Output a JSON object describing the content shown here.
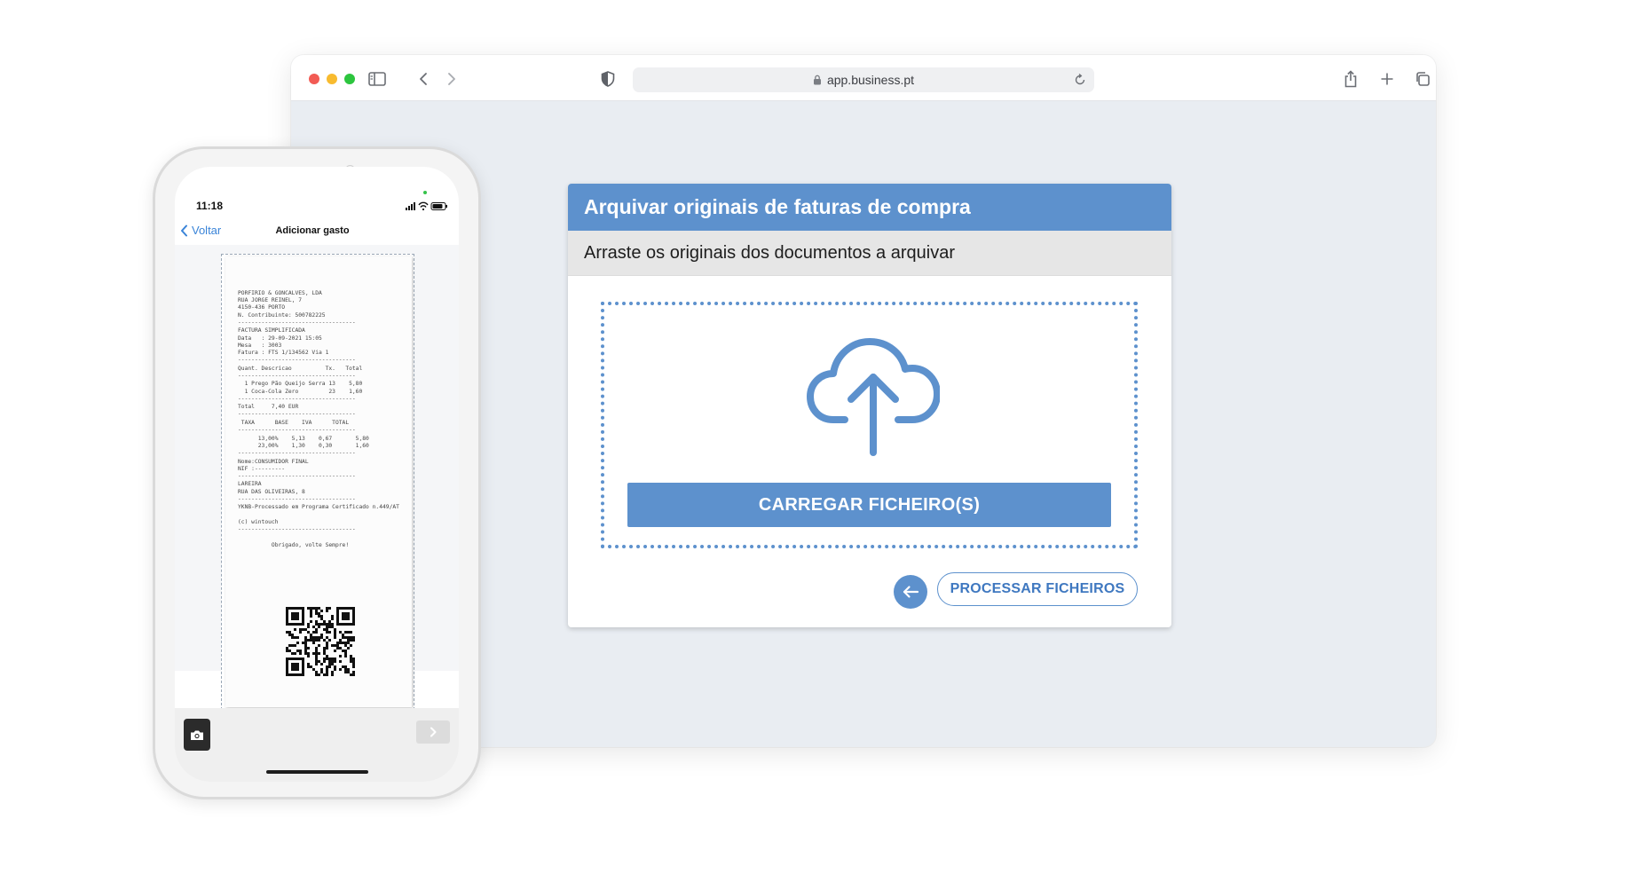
{
  "browser": {
    "url": "app.business.pt"
  },
  "card": {
    "title": "Arquivar originais de faturas de compra",
    "subtitle": "Arraste os originais dos documentos a arquivar",
    "upload_label": "CARREGAR FICHEIRO(S)",
    "process_label": "PROCESSAR FICHEIROS"
  },
  "phone": {
    "time": "11:18",
    "back_label": "Voltar",
    "title": "Adicionar gasto",
    "receipt_lines": [
      "PORFIRIO & GONCALVES, LDA",
      "RUA JORGE REINEL, 7",
      "4150-436 PORTO",
      "N. Contribuinte: 500782225",
      "-----------------------------------",
      "FACTURA SIMPLIFICADA",
      "Data   : 29-09-2021 15:05",
      "Mesa   : 3003",
      "Fatura : FTS 1/134562 Via 1",
      "-----------------------------------",
      "Quant. Descricao          Tx.   Total",
      "-----------------------------------",
      "  1 Prego Pão Queijo Serra 13    5,80",
      "  1 Coca-Cola Zero         23    1,60",
      "-----------------------------------",
      "Total     7,40 EUR",
      "-----------------------------------",
      " TAXA      BASE    IVA      TOTAL",
      "-----------------------------------",
      "      13,00%    5,13    0,67       5,80",
      "      23,00%    1,30    0,30       1,60",
      "-----------------------------------",
      "Nome:CONSUMIDOR FINAL",
      "NIF :---------",
      "-----------------------------------",
      "LAREIRA",
      "RUA DAS OLIVEIRAS, 8",
      "-----------------------------------",
      "YKNB-Processado em Programa Certificado n.449/AT",
      "",
      "(c) wintouch",
      "-----------------------------------",
      "",
      "          Obrigado, volte Sempre!"
    ]
  },
  "colors": {
    "accent": "#5d91cd",
    "link": "#3a84d8",
    "page_bg": "#e9edf2"
  }
}
